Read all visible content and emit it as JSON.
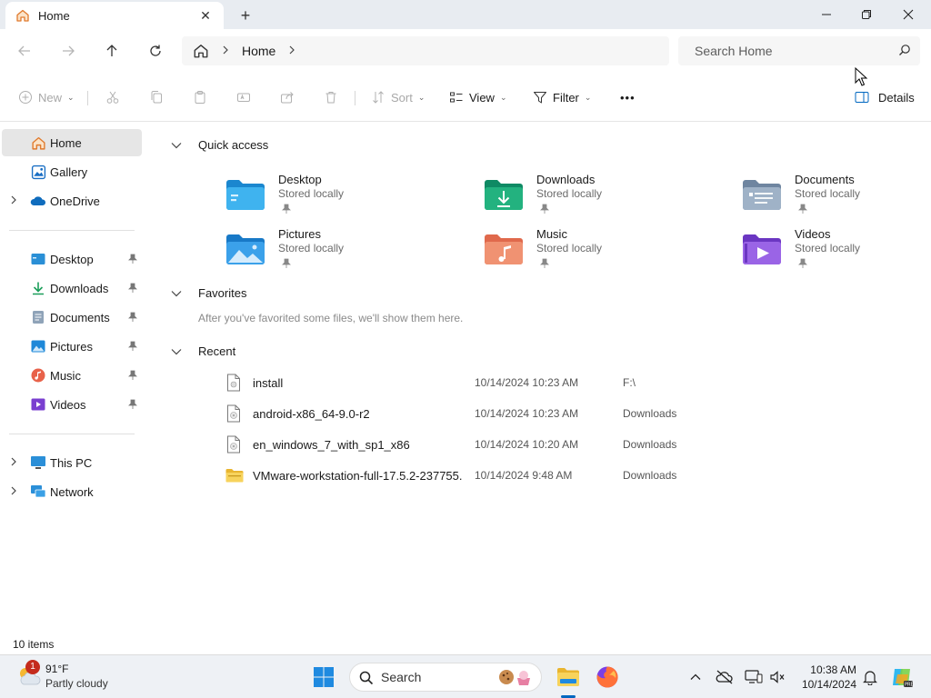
{
  "window": {
    "tab_title": "Home",
    "tab_close": "✕",
    "new_tab": "+",
    "minimize": "—",
    "maximize": "❐",
    "close": "✕"
  },
  "address": {
    "breadcrumb": [
      "Home"
    ],
    "search_placeholder": "Search Home"
  },
  "commands": {
    "new": "New",
    "sort": "Sort",
    "view": "View",
    "filter": "Filter",
    "more": "•••",
    "details": "Details"
  },
  "sidebar": {
    "top": [
      {
        "label": "Home",
        "icon": "home-icon",
        "active": true
      },
      {
        "label": "Gallery",
        "icon": "gallery-icon"
      },
      {
        "label": "OneDrive",
        "icon": "onedrive-icon",
        "expandable": true
      }
    ],
    "pinned": [
      {
        "label": "Desktop",
        "icon": "desktop-icon"
      },
      {
        "label": "Downloads",
        "icon": "downloads-icon"
      },
      {
        "label": "Documents",
        "icon": "documents-icon"
      },
      {
        "label": "Pictures",
        "icon": "pictures-icon"
      },
      {
        "label": "Music",
        "icon": "music-icon"
      },
      {
        "label": "Videos",
        "icon": "videos-icon"
      }
    ],
    "bottom": [
      {
        "label": "This PC",
        "icon": "this-pc-icon"
      },
      {
        "label": "Network",
        "icon": "network-icon"
      }
    ]
  },
  "content": {
    "quick_access_title": "Quick access",
    "quick_access": [
      {
        "name": "Desktop",
        "sub": "Stored locally",
        "icon": "desktop-folder-icon"
      },
      {
        "name": "Downloads",
        "sub": "Stored locally",
        "icon": "downloads-folder-icon"
      },
      {
        "name": "Documents",
        "sub": "Stored locally",
        "icon": "documents-folder-icon"
      },
      {
        "name": "Pictures",
        "sub": "Stored locally",
        "icon": "pictures-folder-icon"
      },
      {
        "name": "Music",
        "sub": "Stored locally",
        "icon": "music-folder-icon"
      },
      {
        "name": "Videos",
        "sub": "Stored locally",
        "icon": "videos-folder-icon"
      }
    ],
    "favorites_title": "Favorites",
    "favorites_empty": "After you've favorited some files, we'll show them here.",
    "recent_title": "Recent",
    "recent": [
      {
        "name": "install",
        "date": "10/14/2024 10:23 AM",
        "location": "F:\\",
        "icon": "file-icon"
      },
      {
        "name": "android-x86_64-9.0-r2",
        "date": "10/14/2024 10:23 AM",
        "location": "Downloads",
        "icon": "disc-image-icon"
      },
      {
        "name": "en_windows_7_with_sp1_x86",
        "date": "10/14/2024 10:20 AM",
        "location": "Downloads",
        "icon": "disc-image-icon"
      },
      {
        "name": "VMware-workstation-full-17.5.2-237755...",
        "date": "10/14/2024 9:48 AM",
        "location": "Downloads",
        "icon": "folder-icon"
      }
    ]
  },
  "status": {
    "item_count": "10 items"
  },
  "taskbar": {
    "weather_temp": "91°F",
    "weather_desc": "Partly cloudy",
    "weather_badge": "1",
    "search_label": "Search",
    "time": "10:38 AM",
    "date": "10/14/2024"
  },
  "colors": {
    "accent": "#0067c0",
    "folder_yellow": "#f5c542"
  }
}
